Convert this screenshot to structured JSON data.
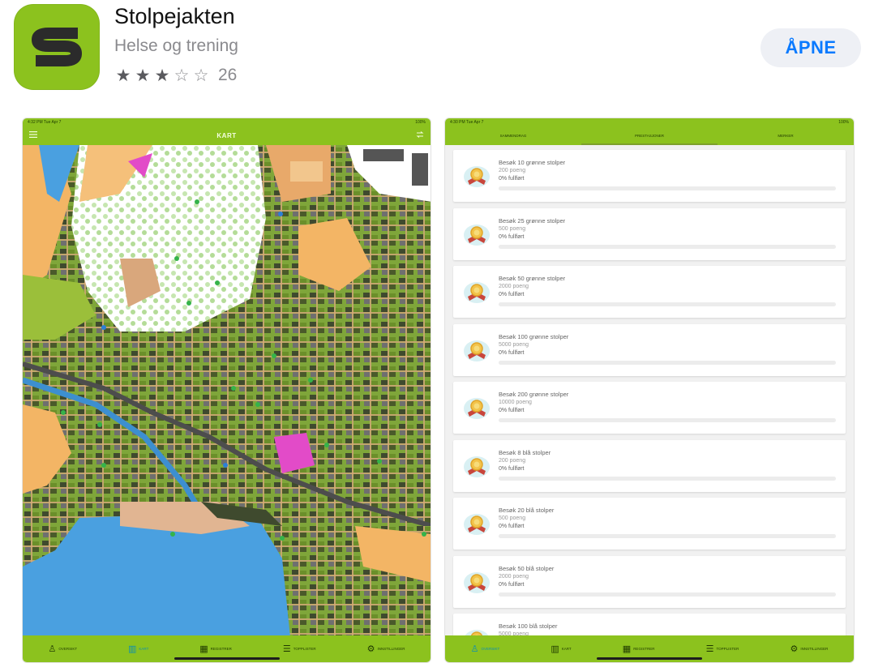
{
  "app": {
    "name": "Stolpejakten",
    "category": "Helse og trening",
    "rating_value": 3,
    "rating_max": 5,
    "rating_count": "26",
    "open_label": "ÅPNE",
    "icon_letter": "S",
    "brand_color": "#8cc21e",
    "button_color": "#0a7aff"
  },
  "screenshot1": {
    "status_time": "4:32 PM  Tue Apr 7",
    "status_right": "100%",
    "nav_title": "KART",
    "menu_icon": "hamburger-icon",
    "swap_icon": "arrows-swap-icon",
    "tabs": [
      {
        "label": "OVERSIKT",
        "icon": "person-check-icon",
        "active": false
      },
      {
        "label": "KART",
        "icon": "map-icon",
        "active": true
      },
      {
        "label": "REGISTRER",
        "icon": "qr-code-icon",
        "active": false
      },
      {
        "label": "TOPPLISTER",
        "icon": "list-icon",
        "active": false
      },
      {
        "label": "INNSTILLINGER",
        "icon": "gear-icon",
        "active": false
      }
    ]
  },
  "screenshot2": {
    "status_time": "4:30 PM  Tue Apr 7",
    "status_right": "100%",
    "segments": [
      {
        "label": "SAMMENDRAG",
        "active": false
      },
      {
        "label": "PRESTASJONER",
        "active": true
      },
      {
        "label": "MERKER",
        "active": false
      }
    ],
    "achievements": [
      {
        "title": "Besøk 10 grønne stolper",
        "points": "200 poeng",
        "progress_text": "0% fullført",
        "progress": 0
      },
      {
        "title": "Besøk 25 grønne stolper",
        "points": "500 poeng",
        "progress_text": "0% fullført",
        "progress": 0
      },
      {
        "title": "Besøk 50 grønne stolper",
        "points": "2000 poeng",
        "progress_text": "0% fullført",
        "progress": 0
      },
      {
        "title": "Besøk 100 grønne stolper",
        "points": "5000 poeng",
        "progress_text": "0% fullført",
        "progress": 0
      },
      {
        "title": "Besøk 200 grønne stolper",
        "points": "10000 poeng",
        "progress_text": "0% fullført",
        "progress": 0
      },
      {
        "title": "Besøk 8 blå stolper",
        "points": "200 poeng",
        "progress_text": "0% fullført",
        "progress": 0
      },
      {
        "title": "Besøk 20 blå stolper",
        "points": "500 poeng",
        "progress_text": "0% fullført",
        "progress": 0
      },
      {
        "title": "Besøk 50 blå stolper",
        "points": "2000 poeng",
        "progress_text": "0% fullført",
        "progress": 0
      },
      {
        "title": "Besøk 100 blå stolper",
        "points": "5000 poeng",
        "progress_text": "",
        "progress": 0
      }
    ],
    "tabs": [
      {
        "label": "OVERSIKT",
        "icon": "person-check-icon",
        "active": true
      },
      {
        "label": "KART",
        "icon": "map-icon",
        "active": false
      },
      {
        "label": "REGISTRER",
        "icon": "qr-code-icon",
        "active": false
      },
      {
        "label": "TOPPLISTER",
        "icon": "list-icon",
        "active": false
      },
      {
        "label": "INNSTILLINGER",
        "icon": "gear-icon",
        "active": false
      }
    ]
  }
}
